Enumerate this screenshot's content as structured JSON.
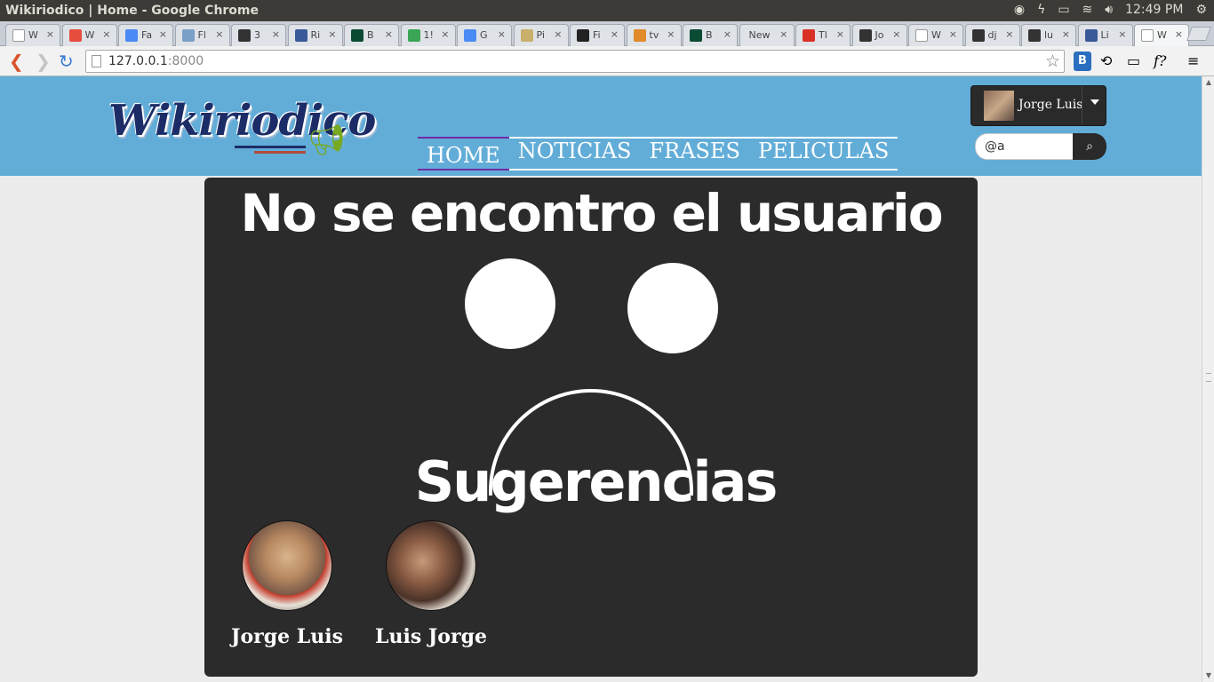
{
  "window": {
    "title": "Wikiriodico | Home - Google Chrome",
    "clock": "12:49 PM"
  },
  "tabs": [
    {
      "label": "W",
      "favicon": "page-icon",
      "color": "#ffffff"
    },
    {
      "label": "W",
      "favicon": "google-icon",
      "color": "#e74c3c"
    },
    {
      "label": "Fa",
      "favicon": "google-search-icon",
      "color": "#4a8af4"
    },
    {
      "label": "Fl",
      "favicon": "cloud-icon",
      "color": "#7aa0c8"
    },
    {
      "label": "3",
      "favicon": "bracket-icon",
      "color": "#333333"
    },
    {
      "label": "Ri",
      "favicon": "facebook-icon",
      "color": "#3b5998"
    },
    {
      "label": "B",
      "favicon": "django-icon",
      "color": "#0c4b33"
    },
    {
      "label": "1!",
      "favicon": "refresh-icon",
      "color": "#3aa655"
    },
    {
      "label": "G",
      "favicon": "google-search-icon",
      "color": "#4a8af4"
    },
    {
      "label": "Pi",
      "favicon": "g-icon",
      "color": "#c8b06a"
    },
    {
      "label": "Fi",
      "favicon": "flag-icon",
      "color": "#222222"
    },
    {
      "label": "tv",
      "favicon": "stack-icon",
      "color": "#e08a2a"
    },
    {
      "label": "B",
      "favicon": "django-icon",
      "color": "#0c4b33"
    },
    {
      "label": "New",
      "favicon": "",
      "color": ""
    },
    {
      "label": "Tl",
      "favicon": "gmail-icon",
      "color": "#d93025"
    },
    {
      "label": "Jo",
      "favicon": "bulb-icon",
      "color": "#333333"
    },
    {
      "label": "W",
      "favicon": "page-icon",
      "color": "#ffffff"
    },
    {
      "label": "dj",
      "favicon": "github-icon",
      "color": "#333333"
    },
    {
      "label": "lu",
      "favicon": "github-icon",
      "color": "#333333"
    },
    {
      "label": "Li",
      "favicon": "facebook-icon",
      "color": "#3b5998"
    },
    {
      "label": "W",
      "favicon": "page-icon",
      "color": "#ffffff",
      "active": true
    }
  ],
  "omnibox": {
    "host": "127.0.0.1",
    "port": ":8000"
  },
  "site": {
    "logo_text": "Wikiriodico",
    "nav": [
      "HOME",
      "NOTICIAS",
      "FRASES",
      "PELICULAS"
    ],
    "user_name": "Jorge Luis",
    "search_value": "@a",
    "header_color": "#62add8"
  },
  "content": {
    "title": "No se encontro el usuario",
    "suggestions_title": "Sugerencias",
    "suggestions": [
      {
        "name": "Jorge Luis"
      },
      {
        "name": "Luis Jorge"
      }
    ]
  }
}
